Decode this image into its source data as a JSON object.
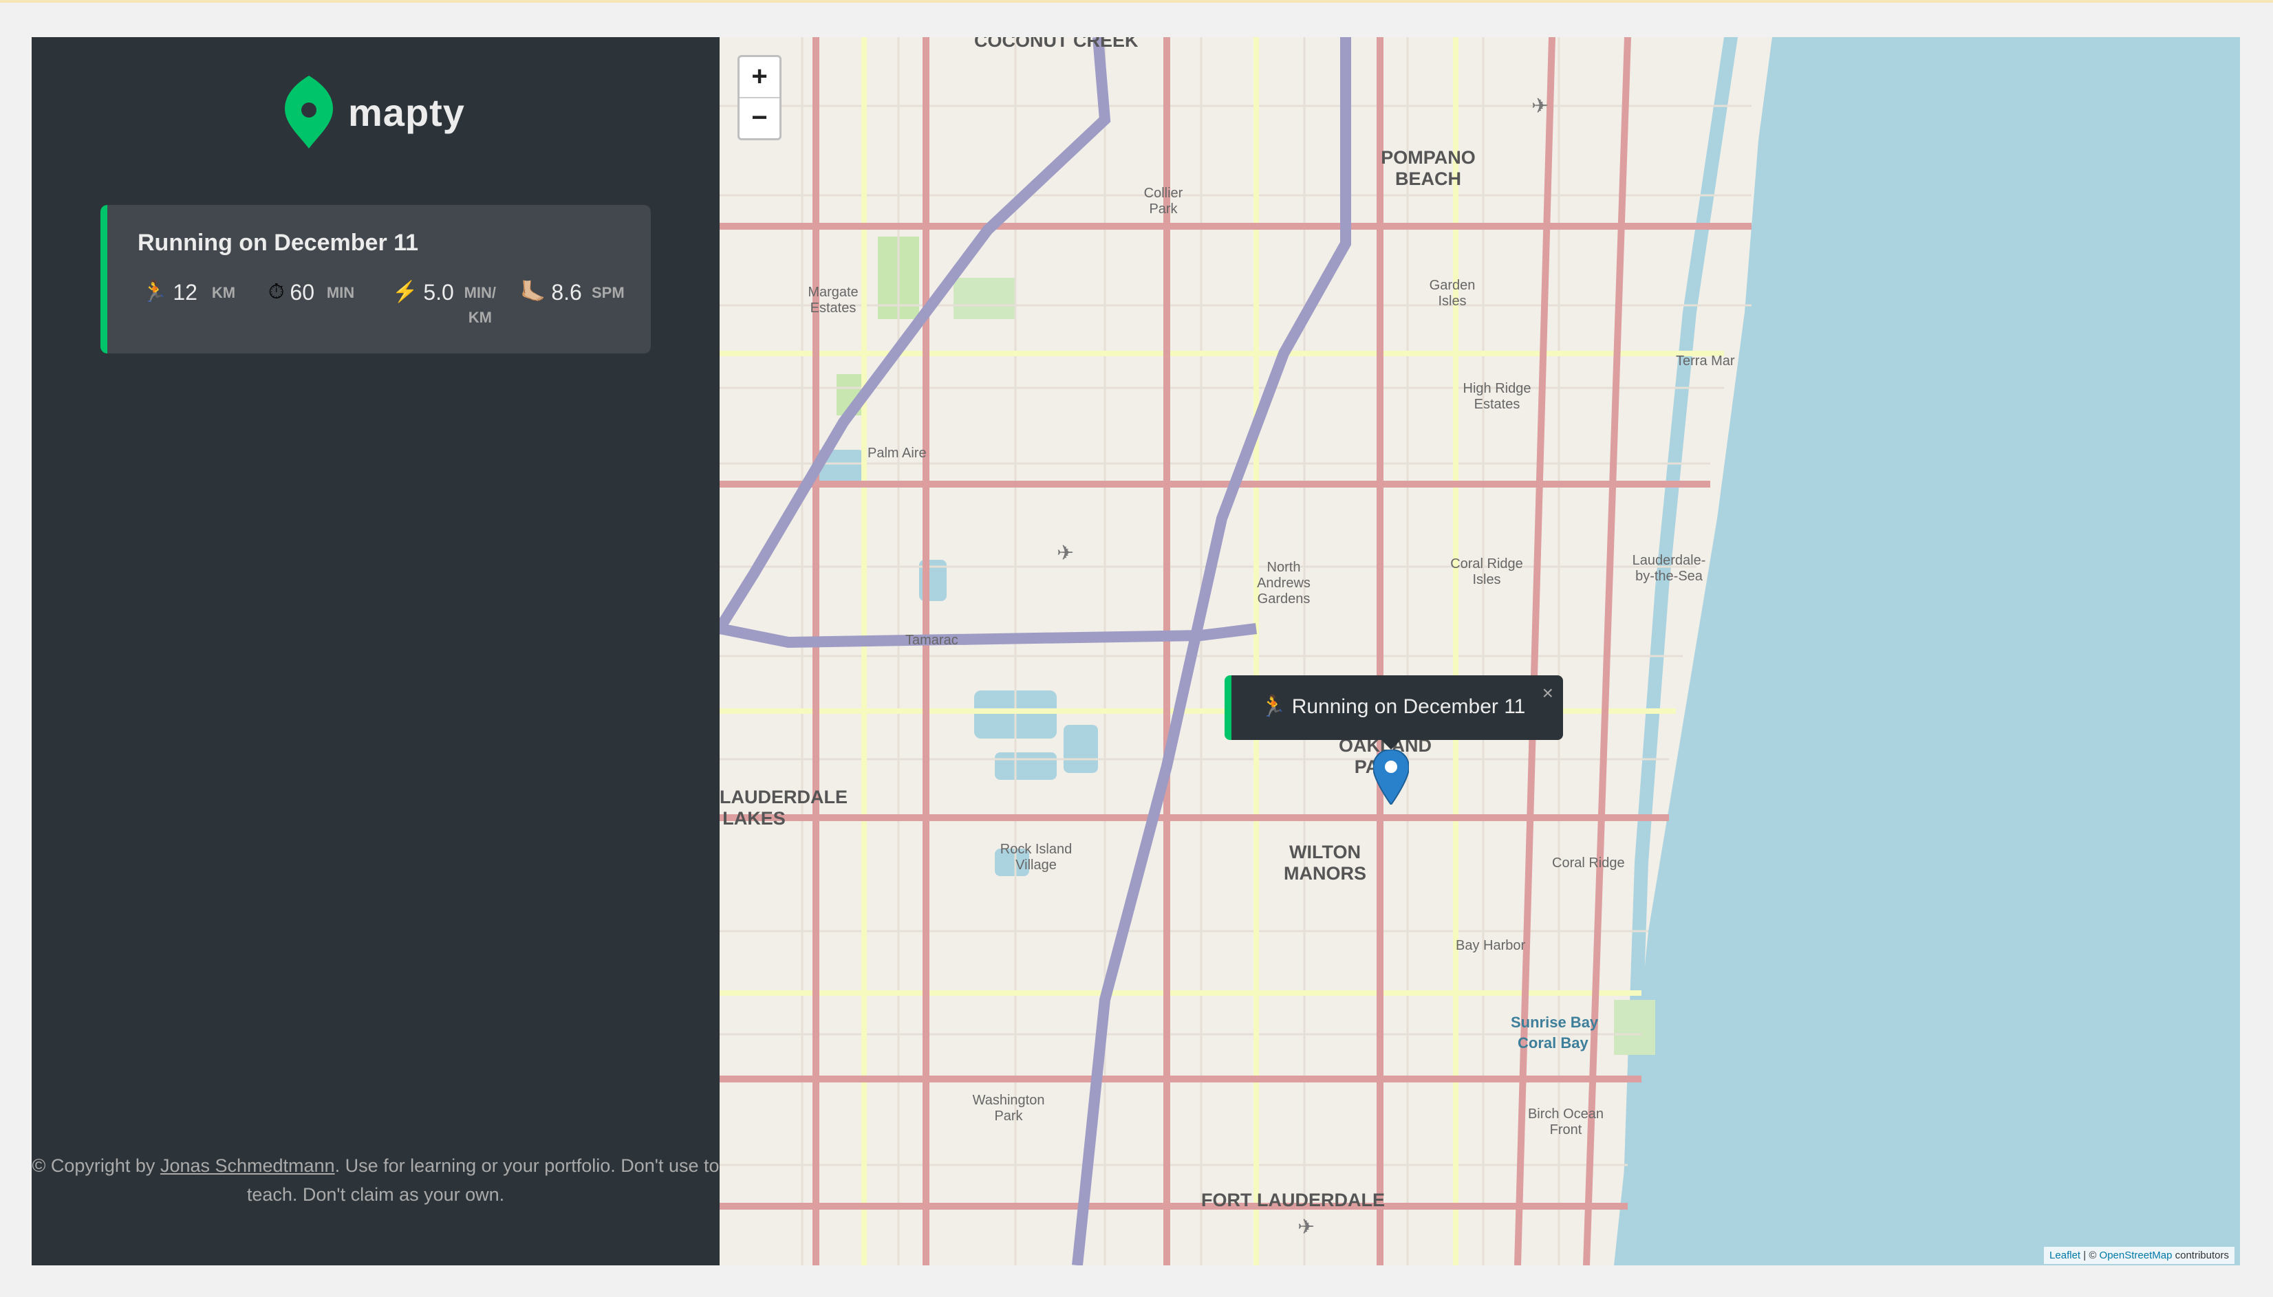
{
  "app": {
    "name": "mapty"
  },
  "workout": {
    "title": "Running on December 11",
    "details": [
      {
        "icon": "🏃",
        "value": "12",
        "unit": "KM"
      },
      {
        "icon": "⏱",
        "value": "60",
        "unit": "MIN"
      },
      {
        "icon": "⚡️",
        "value": "5.0",
        "unit": "MIN/ KM"
      },
      {
        "icon": "🦶🏼",
        "value": "8.6",
        "unit": "SPM"
      }
    ]
  },
  "footer": {
    "prefix": "© Copyright by ",
    "author": "Jonas Schmedtmann",
    "suffix": ". Use for learning or your portfolio. Don't use to teach. Don't claim as your own."
  },
  "map": {
    "zoom_in": "+",
    "zoom_out": "−",
    "popup": {
      "icon": "🏃",
      "text": "Running on December 11",
      "close": "×"
    },
    "attribution": {
      "leaflet": "Leaflet",
      "sep": " | © ",
      "osm": "OpenStreetMap",
      "suffix": " contributors"
    },
    "labels": {
      "coconut_creek": "COCONUT CREEK",
      "pompano_beach": "POMPANO BEACH",
      "oakland_park": "OAKLAND PARK",
      "wilton_manors": "WILTON MANORS",
      "lauderdale_lakes": "LAUDERDALE LAKES",
      "fort_lauderdale": "FORT LAUDERDALE",
      "margate_estates": "Margate Estates",
      "collier_park": "Collier Park",
      "garden_isles": "Garden Isles",
      "high_ridge_estates": "High Ridge Estates",
      "north_andrews_gardens": "North Andrews Gardens",
      "coral_ridge_isles": "Coral Ridge Isles",
      "lauderdale_by_the_sea": "Lauderdale-by-the-Sea",
      "coral_ridge": "Coral Ridge",
      "bay_harbor": "Bay Harbor",
      "rock_island_village": "Rock Island Village",
      "washington_park": "Washington Park",
      "sunrise_bay": "Sunrise Bay",
      "coral_bay": "Coral Bay",
      "birch_ocean_front": "Birch Ocean Front",
      "tamarac": "Tamarac",
      "palm_aire": "Palm Aire",
      "terra_mar": "Terra Mar"
    }
  },
  "colors": {
    "accent": "#00c46a",
    "sidebar": "#2d3439",
    "card": "#42484d",
    "water": "#aad3df",
    "marker": "#2a81cb"
  }
}
